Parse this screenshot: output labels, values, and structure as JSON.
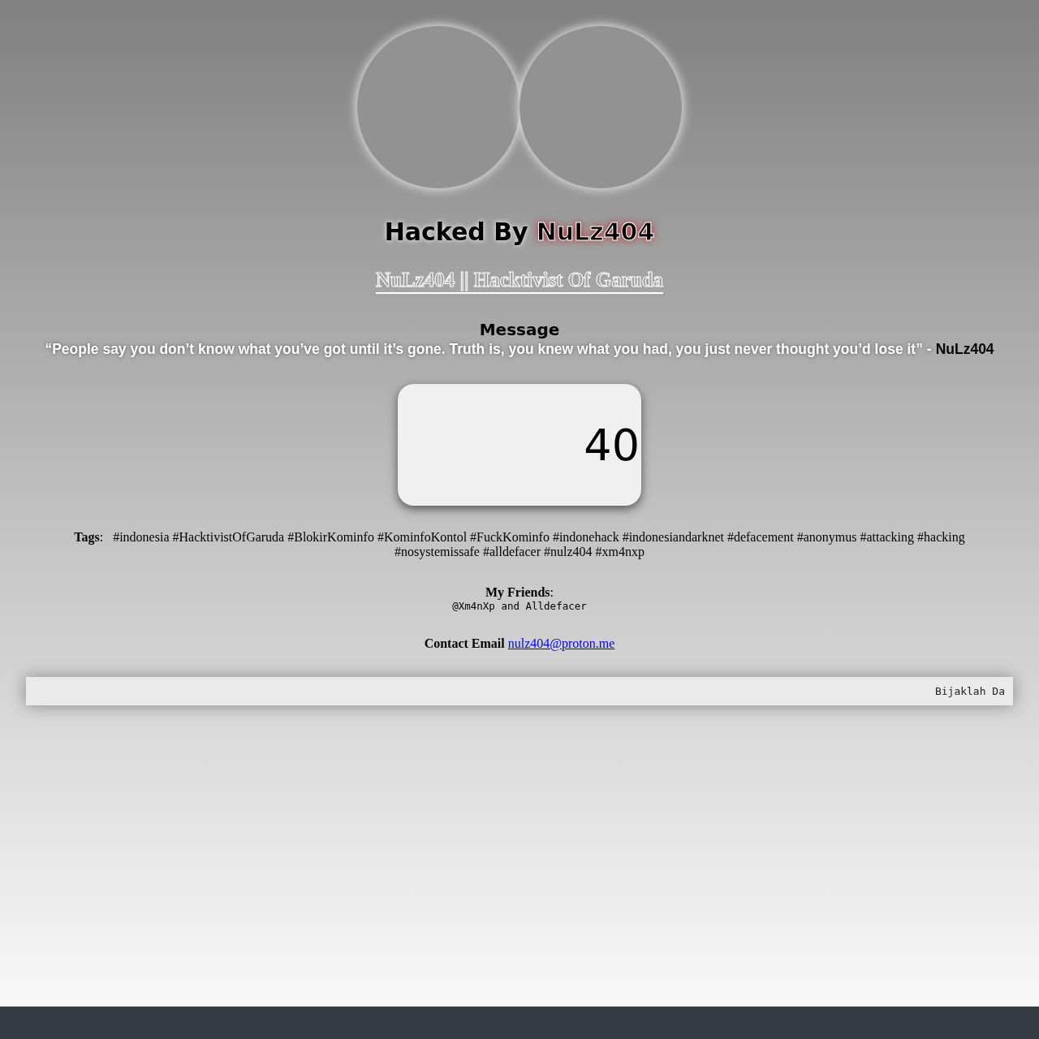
{
  "heading": {
    "text": "Hacked By",
    "name": "NuLz404"
  },
  "subtitle": "NuLz404 || Hacktivist Of Garuda",
  "message": {
    "title": "Message",
    "quote": "“People say you don’t know what you’ve got until it’s gone. Truth is, you knew what you had, you just never thought you’d lose it” -",
    "author": "NuLz404"
  },
  "card": {
    "text": "40"
  },
  "tags": "**Tags**:   #indonesia #HacktivistOfGaruda #BlokirKominfo #KominfoKontol #FuckKominfo #indonehack #indonesiandarknet #defacement #anonymus #attacking #hacking #nosystemissafe #alldefacer #nulz404 #xm4nxp",
  "friends": {
    "label": "**My Friends**:",
    "names": "@Xm4nXp and Alldefacer"
  },
  "contact": {
    "label": "Contact Email",
    "email": "nulz404@proton.me"
  },
  "marquee": "Bijaklah Da"
}
